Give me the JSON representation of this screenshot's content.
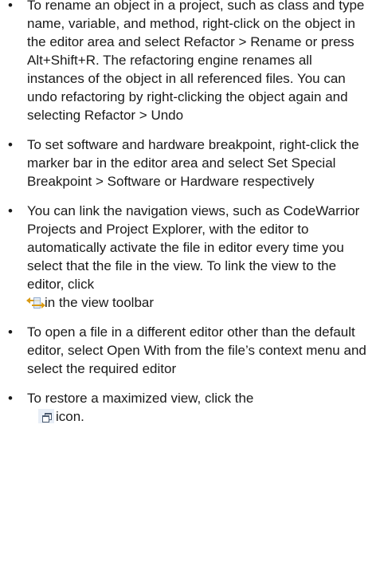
{
  "bullet_glyph": "•",
  "tips": [
    {
      "text": "To rename an object in a project, such as class and type name, variable, and method, right-click on the object in the editor area and select Refactor > Rename or press Alt+Shift+R. The refactoring engine renames all instances of the object in all referenced files. You can undo refactoring by right-clicking the object again and selecting Refactor > Undo"
    },
    {
      "text": "To set software and hardware breakpoint, right-click the marker bar in the editor area and select Set Special Breakpoint > Software or Hardware respectively"
    },
    {
      "text": "You can link the navigation views, such as CodeWarrior Projects and Project Explorer, with the editor to automatically activate the file in editor every time you select that the file in the view. To link the view to the editor, click",
      "icon": "link-with-editor-icon",
      "after": "in the view toolbar"
    },
    {
      "text": "To open a file in a different editor other than the default editor, select Open With from the file’s context menu and select the required editor"
    },
    {
      "text": "To restore a maximized view, click the",
      "icon": "restore-view-icon",
      "after": "icon."
    }
  ]
}
